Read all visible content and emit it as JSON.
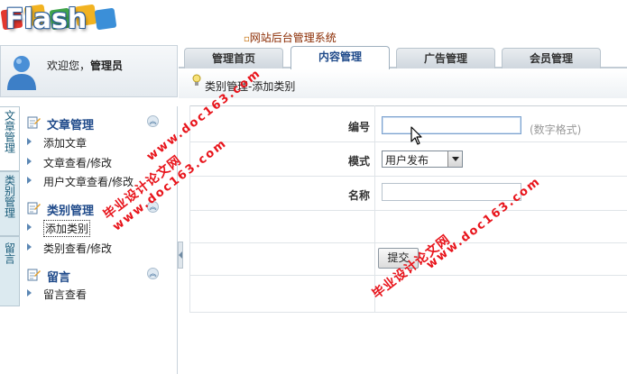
{
  "logo": {
    "text": "Flash"
  },
  "header": {
    "system_title": "网站后台管理系统",
    "welcome_prefix": "欢迎您，",
    "username": "管理员"
  },
  "tabs": [
    {
      "label": "管理首页",
      "active": false
    },
    {
      "label": "内容管理",
      "active": true
    },
    {
      "label": "广告管理",
      "active": false
    },
    {
      "label": "会员管理",
      "active": false
    }
  ],
  "breadcrumb": "类别管理-添加类别",
  "vtabs": [
    "文章管理",
    "类别管理",
    "留言"
  ],
  "sidebar": {
    "sections": [
      {
        "title": "文章管理",
        "items": [
          "添加文章",
          "文章查看/修改",
          "用户文章查看/修改"
        ]
      },
      {
        "title": "类别管理",
        "items": [
          "添加类别",
          "类别查看/修改"
        ]
      },
      {
        "title": "留言",
        "items": [
          "留言查看"
        ]
      }
    ]
  },
  "form": {
    "code_label": "编号",
    "code_value": "",
    "code_hint": "(数字格式)",
    "mode_label": "模式",
    "mode_value": "用户发布",
    "name_label": "名称",
    "name_value": "",
    "submit_label": "提交"
  },
  "watermark": {
    "cn": "毕业设计论文网",
    "en": "www.doc163.com"
  },
  "colors": {
    "accent": "#1f4a8a",
    "watermark": "#e8141b",
    "tab_bg": "#cfd7de"
  }
}
